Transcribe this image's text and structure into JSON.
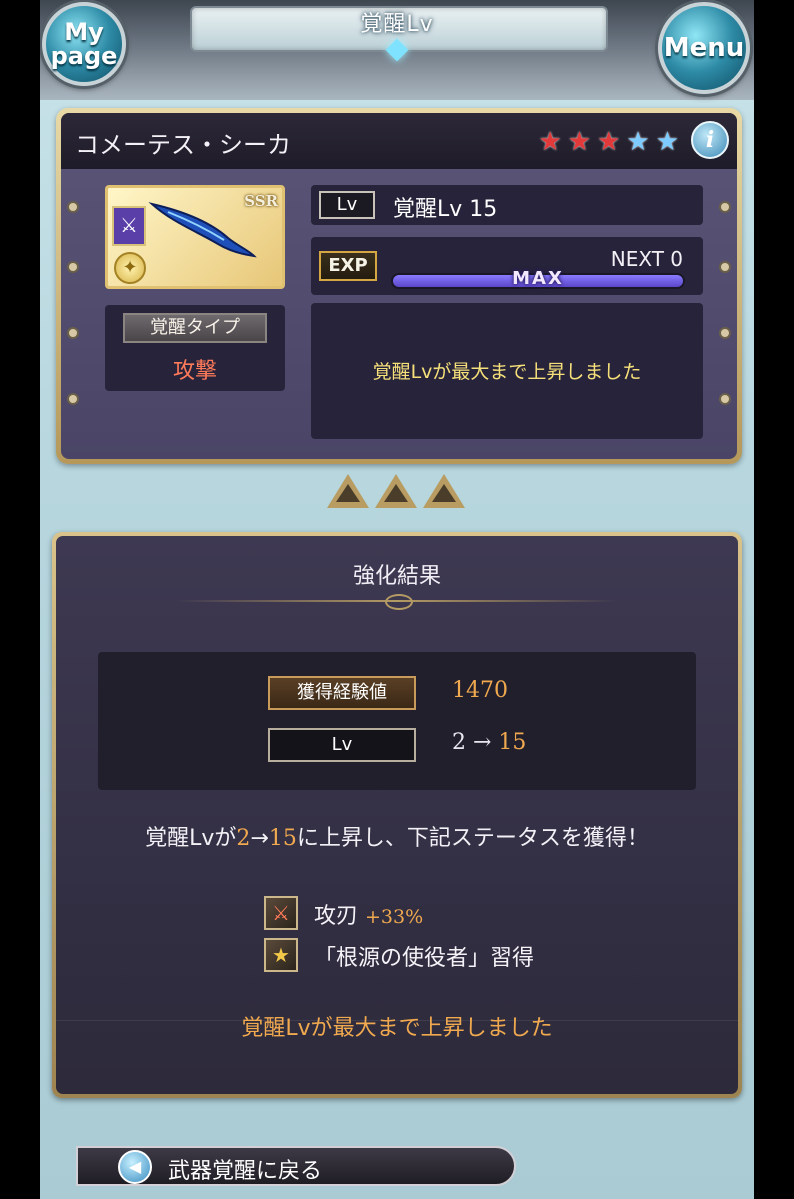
{
  "header": {
    "title": "覚醒Lv",
    "mypage_label_1": "My",
    "mypage_label_2": "page",
    "menu_label": "Menu"
  },
  "card": {
    "name": "コメーテス・シーカ",
    "rarity_stars_filled": 3,
    "rarity_stars_total": 5,
    "rarity_badge": "SSR",
    "info_label": "i",
    "awakening_type_label": "覚醒タイプ",
    "awakening_type_value": "攻撃",
    "lv_tag": "Lv",
    "lv_value": "覚醒Lv 15",
    "exp_tag": "EXP",
    "next_label": "NEXT 0",
    "exp_progress": 1.0,
    "exp_bar_label": "MAX",
    "message": "覚醒Lvが最大まで上昇しました"
  },
  "result": {
    "title": "強化結果",
    "exp_label": "獲得経験値",
    "exp_value": "1470",
    "lv_label": "Lv",
    "lv_from": "2 → ",
    "lv_to": "15",
    "sentence_pre": "覚醒Lvが",
    "sentence_from": "2",
    "sentence_arrow": "→",
    "sentence_to": "15",
    "sentence_post": "に上昇し、下記ステータスを獲得！",
    "bonuses": [
      {
        "icon": "attack-up-icon",
        "name": "攻刃",
        "value": "+33%"
      },
      {
        "icon": "star-icon",
        "name": "「根源の使役者」習得",
        "value": ""
      }
    ],
    "footer": "覚醒Lvが最大まで上昇しました"
  },
  "back_button": {
    "label": "武器覚醒に戻る"
  },
  "colors": {
    "accent_orange": "#f0a94f",
    "message_yellow": "#f6e07a",
    "type_red": "#ff7b5a",
    "exp_bar": "#6a56e0"
  }
}
